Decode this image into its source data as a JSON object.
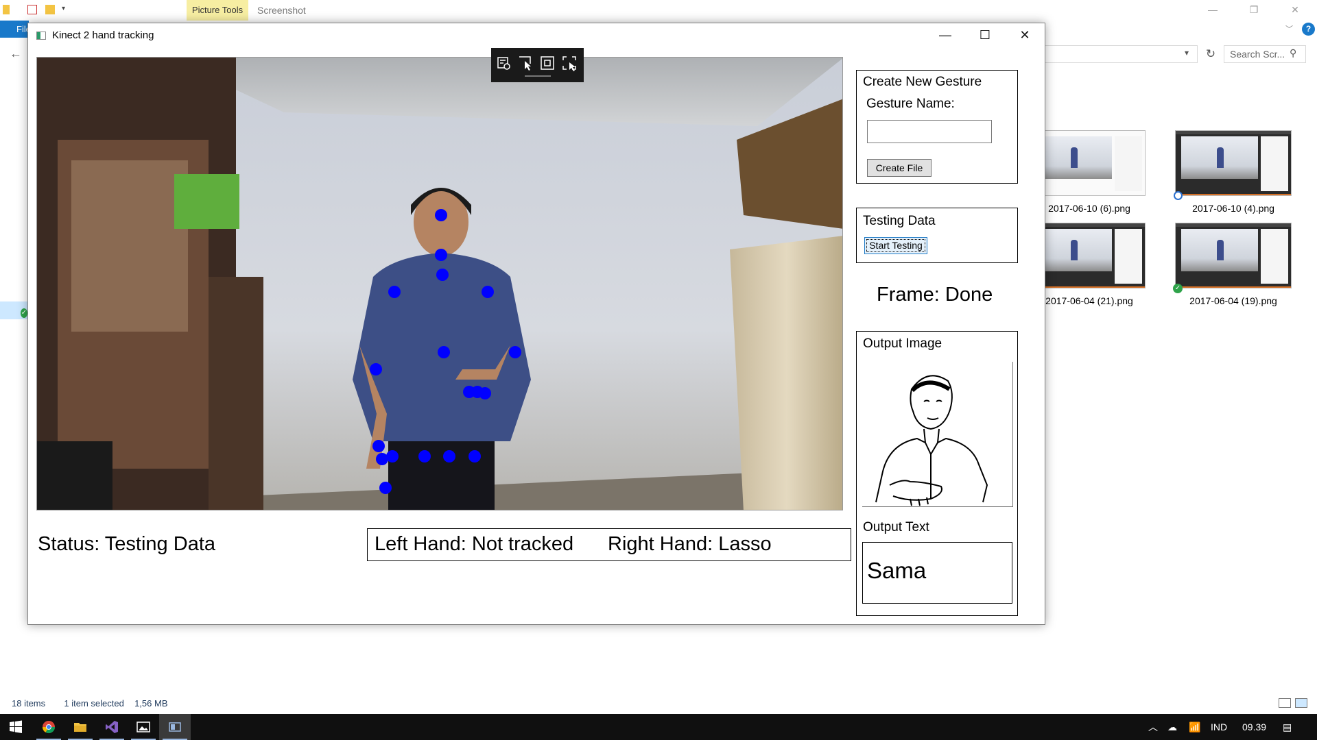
{
  "explorer": {
    "context_tab": "Picture Tools",
    "ribbon_title": "Screenshot",
    "file_tab": "File",
    "search_placeholder": "Search Scr...",
    "files": [
      {
        "name": "2017-06-10 (6).png"
      },
      {
        "name": "2017-06-10 (4).png"
      },
      {
        "name": "2017-06-04 (21).png"
      },
      {
        "name": "2017-06-04 (19).png"
      }
    ],
    "status": {
      "items": "18 items",
      "selected": "1 item selected",
      "size": "1,56 MB"
    }
  },
  "app": {
    "title": "Kinect 2 hand tracking",
    "create_panel": {
      "title": "Create New Gesture",
      "name_label": "Gesture Name:",
      "name_value": "",
      "button": "Create File"
    },
    "testing_panel": {
      "title": "Testing Data",
      "button": "Start Testing"
    },
    "frame_status": "Frame: Done",
    "output_image_label": "Output Image",
    "output_text_label": "Output Text",
    "output_text_value": "Sama",
    "status": "Status: Testing Data",
    "left_hand": "Left Hand: Not tracked",
    "right_hand": "Right Hand: Lasso",
    "joint_color": "#0000ff"
  },
  "snip_toolbar": {
    "icons": [
      "snip-settings-icon",
      "free-form-snip-icon",
      "window-snip-icon",
      "fullscreen-snip-icon"
    ]
  },
  "taskbar": {
    "apps": [
      "windows-start-icon",
      "chrome-icon",
      "file-explorer-icon",
      "visual-studio-icon",
      "photos-icon",
      "kinect-app-icon"
    ],
    "language": "IND",
    "time": "09.39"
  }
}
